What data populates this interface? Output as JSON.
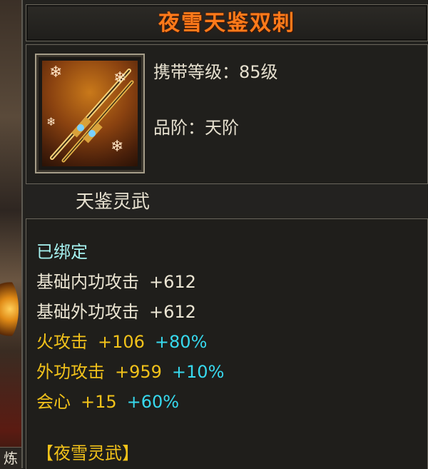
{
  "tooltip": {
    "title": "夜雪天鉴双刺",
    "item_icon": "twin-daggers-snowflake-icon",
    "level_label": "携带等级",
    "level_value": "85级",
    "grade_label": "品阶",
    "grade_value": "天阶",
    "colon": "：",
    "set_category": "天鉴灵武",
    "bound_status": "已绑定",
    "stats": [
      {
        "name": "基础内功攻击",
        "value": "+612",
        "bonus": ""
      },
      {
        "name": "基础外功攻击",
        "value": "+612",
        "bonus": ""
      },
      {
        "name": "火攻击",
        "value": "+106",
        "bonus": "+80%"
      },
      {
        "name": "外功攻击",
        "value": "+959",
        "bonus": "+10%"
      },
      {
        "name": "会心",
        "value": "+15",
        "bonus": "+60%"
      }
    ],
    "set_name_open": "【",
    "set_name": "夜雪灵武",
    "set_name_close": "】"
  },
  "scene": {
    "side_char": "炼"
  },
  "colors": {
    "title": "#ff7a1a",
    "bound": "#a6f2f0",
    "base_stat": "#ece6d4",
    "extra_stat": "#f2c21a",
    "bonus": "#37d9ee"
  }
}
